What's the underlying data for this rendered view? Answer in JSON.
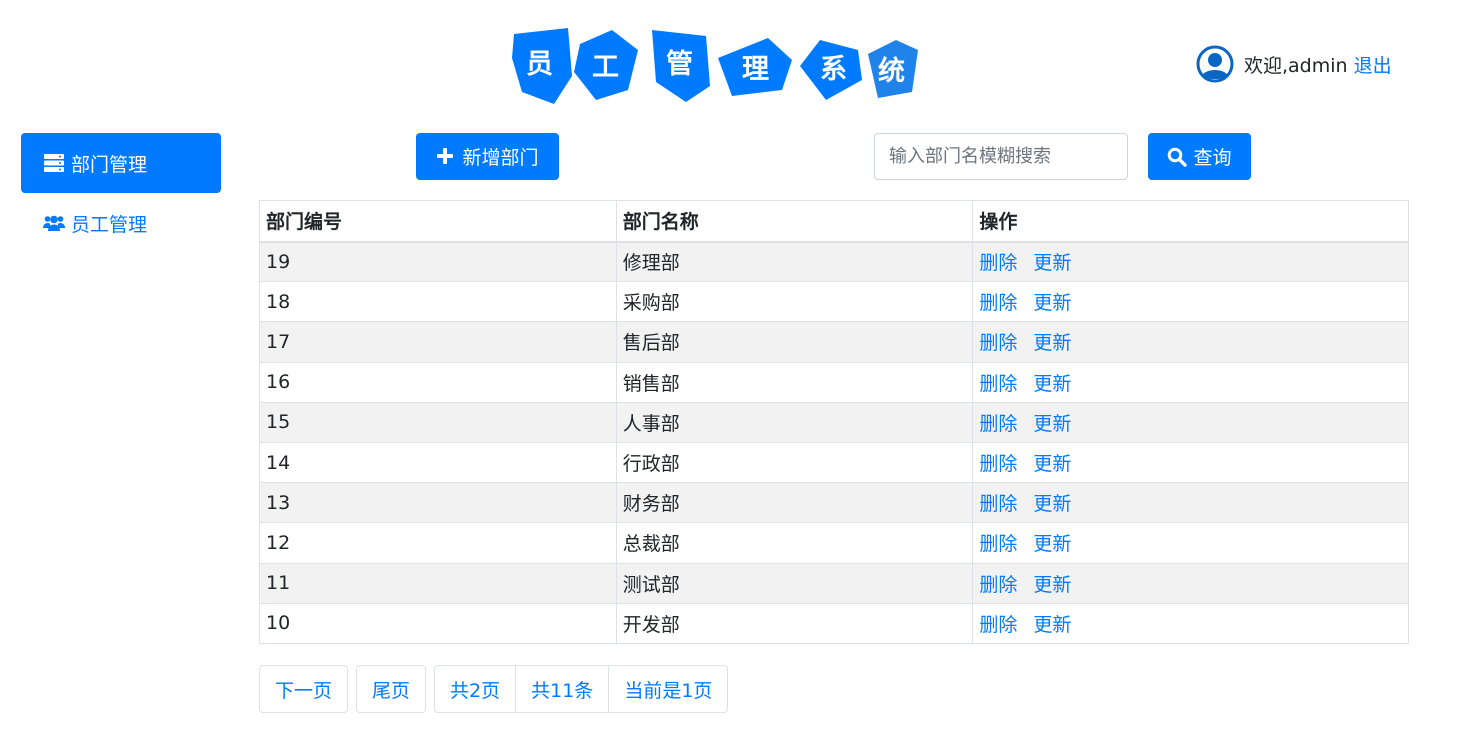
{
  "header": {
    "logo_chars": [
      "员",
      "工",
      "管",
      "理",
      "系",
      "统"
    ],
    "welcome": "欢迎,admin",
    "logout": "退出"
  },
  "sidebar": {
    "items": [
      {
        "label": "部门管理",
        "icon": "server-icon",
        "active": true
      },
      {
        "label": "员工管理",
        "icon": "users-icon",
        "active": false
      }
    ]
  },
  "toolbar": {
    "add_label": "新增部门",
    "search_placeholder": "输入部门名模糊搜索",
    "search_value": "",
    "search_label": "查询"
  },
  "table": {
    "headers": [
      "部门编号",
      "部门名称",
      "操作"
    ],
    "rows": [
      {
        "id": "19",
        "name": "修理部"
      },
      {
        "id": "18",
        "name": "采购部"
      },
      {
        "id": "17",
        "name": "售后部"
      },
      {
        "id": "16",
        "name": "销售部"
      },
      {
        "id": "15",
        "name": "人事部"
      },
      {
        "id": "14",
        "name": "行政部"
      },
      {
        "id": "13",
        "name": "财务部"
      },
      {
        "id": "12",
        "name": "总裁部"
      },
      {
        "id": "11",
        "name": "测试部"
      },
      {
        "id": "10",
        "name": "开发部"
      }
    ],
    "delete_label": "删除",
    "update_label": "更新"
  },
  "pagination": {
    "next": "下一页",
    "last": "尾页",
    "total_pages": "共2页",
    "total_items": "共11条",
    "current": "当前是1页"
  },
  "colors": {
    "primary": "#007bff",
    "stripe": "#f2f2f2"
  }
}
